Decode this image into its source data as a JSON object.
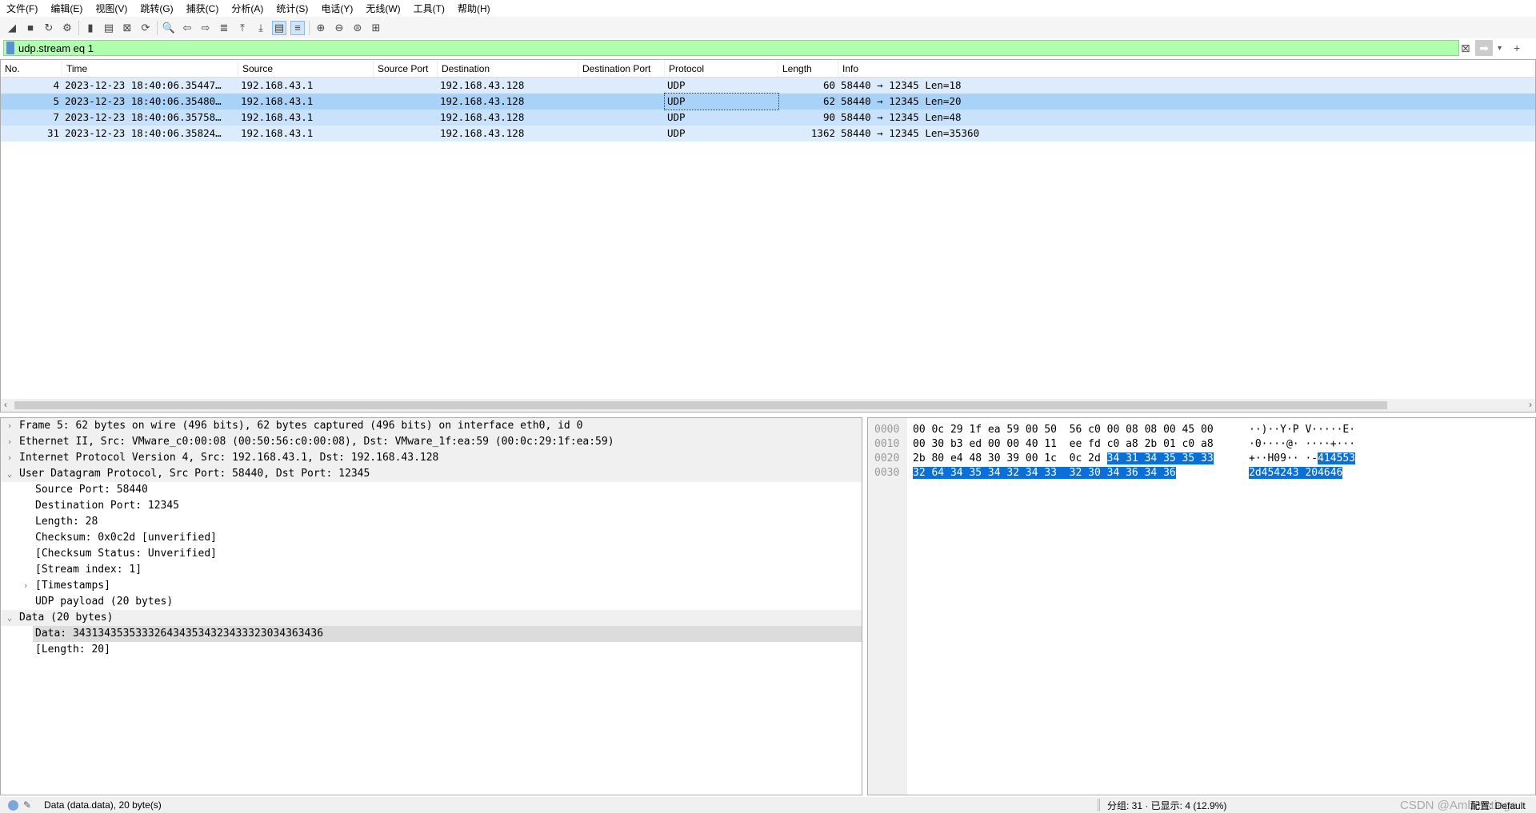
{
  "menu": [
    "文件(F)",
    "编辑(E)",
    "视图(V)",
    "跳转(G)",
    "捕获(C)",
    "分析(A)",
    "统计(S)",
    "电话(Y)",
    "无线(W)",
    "工具(T)",
    "帮助(H)"
  ],
  "toolbar": [
    "shark-fin-start-icon",
    "stop-icon",
    "restart-icon",
    "options-gear-icon",
    "open-folder-icon",
    "save-icon",
    "close-file-icon",
    "reload-icon",
    "find-icon",
    "back-icon",
    "forward-icon",
    "go-to-packet-icon",
    "first-packet-icon",
    "last-packet-icon",
    "autoscroll-icon",
    "colorize-icon",
    "zoom-in-icon",
    "zoom-out-icon",
    "zoom-normal-icon",
    "resize-columns-icon"
  ],
  "filter": {
    "value": "udp.stream eq 1"
  },
  "columns": [
    "No.",
    "Time",
    "Source",
    "Source Port",
    "Destination",
    "Destination Port",
    "Protocol",
    "Length",
    "Info"
  ],
  "packets": [
    {
      "no": "4",
      "time": "2023-12-23 18:40:06.35447…",
      "src": "192.168.43.1",
      "sport": "",
      "dst": "192.168.43.128",
      "dport": "",
      "proto": "UDP",
      "len": "60",
      "info": "58440 → 12345 Len=18"
    },
    {
      "no": "5",
      "time": "2023-12-23 18:40:06.35480…",
      "src": "192.168.43.1",
      "sport": "",
      "dst": "192.168.43.128",
      "dport": "",
      "proto": "UDP",
      "len": "62",
      "info": "58440 → 12345 Len=20"
    },
    {
      "no": "7",
      "time": "2023-12-23 18:40:06.35758…",
      "src": "192.168.43.1",
      "sport": "",
      "dst": "192.168.43.128",
      "dport": "",
      "proto": "UDP",
      "len": "90",
      "info": "58440 → 12345 Len=48"
    },
    {
      "no": "31",
      "time": "2023-12-23 18:40:06.35824…",
      "src": "192.168.43.1",
      "sport": "",
      "dst": "192.168.43.128",
      "dport": "",
      "proto": "UDP",
      "len": "1362",
      "info": "58440 → 12345 Len=35360"
    }
  ],
  "details": [
    {
      "text": "Frame 5: 62 bytes on wire (496 bits), 62 bytes captured (496 bits) on interface eth0, id 0",
      "lvl": 0,
      "arrow": "›",
      "grp": true
    },
    {
      "text": "Ethernet II, Src: VMware_c0:00:08 (00:50:56:c0:00:08), Dst: VMware_1f:ea:59 (00:0c:29:1f:ea:59)",
      "lvl": 0,
      "arrow": "›",
      "grp": true
    },
    {
      "text": "Internet Protocol Version 4, Src: 192.168.43.1, Dst: 192.168.43.128",
      "lvl": 0,
      "arrow": "›",
      "grp": true
    },
    {
      "text": "User Datagram Protocol, Src Port: 58440, Dst Port: 12345",
      "lvl": 0,
      "arrow": "⌄",
      "grp": true
    },
    {
      "text": "Source Port: 58440",
      "lvl": 1
    },
    {
      "text": "Destination Port: 12345",
      "lvl": 1
    },
    {
      "text": "Length: 28",
      "lvl": 1
    },
    {
      "text": "Checksum: 0x0c2d [unverified]",
      "lvl": 1
    },
    {
      "text": "[Checksum Status: Unverified]",
      "lvl": 1
    },
    {
      "text": "[Stream index: 1]",
      "lvl": 1
    },
    {
      "text": "[Timestamps]",
      "lvl": 1,
      "arrow": "›"
    },
    {
      "text": "UDP payload (20 bytes)",
      "lvl": 1
    },
    {
      "text": "Data (20 bytes)",
      "lvl": 0,
      "arrow": "⌄",
      "grp": true
    },
    {
      "text": "Data: 3431343535333264343534323433323034363436",
      "lvl": 1,
      "sel": true
    },
    {
      "text": "[Length: 20]",
      "lvl": 1
    }
  ],
  "hex": [
    {
      "off": "0000",
      "bytes": "00 0c 29 1f ea 59 00 50  56 c0 00 08 08 00 45 00",
      "sel": "",
      "ascii": "··)··Y·P V·····E·",
      "asel": ""
    },
    {
      "off": "0010",
      "bytes": "00 30 b3 ed 00 00 40 11  ee fd c0 a8 2b 01 c0 a8",
      "sel": "",
      "ascii": "·0····@· ····+···",
      "asel": ""
    },
    {
      "off": "0020",
      "bytes": "2b 80 e4 48 30 39 00 1c  0c 2d ",
      "sel": "34 31 34 35 35 33",
      "ascii": "+··H09·· ·-",
      "asel": "414553"
    },
    {
      "off": "0030",
      "bytes": "",
      "sel": "32 64 34 35 34 32 34 33  32 30 34 36 34 36",
      "ascii": "",
      "asel": "2d454243 204646"
    }
  ],
  "status": {
    "left": "Data (data.data), 20 byte(s)",
    "packets": "分组: 31 · 已显示: 4 (12.9%)",
    "profile": "配置: Default",
    "watermark": "CSDN @Amberstiege"
  },
  "colors": {
    "filter_ok": "#afffaf",
    "selected_row": "#a8d2f8",
    "row": "#dcecfd",
    "hex_select": "#0a6fd6"
  }
}
